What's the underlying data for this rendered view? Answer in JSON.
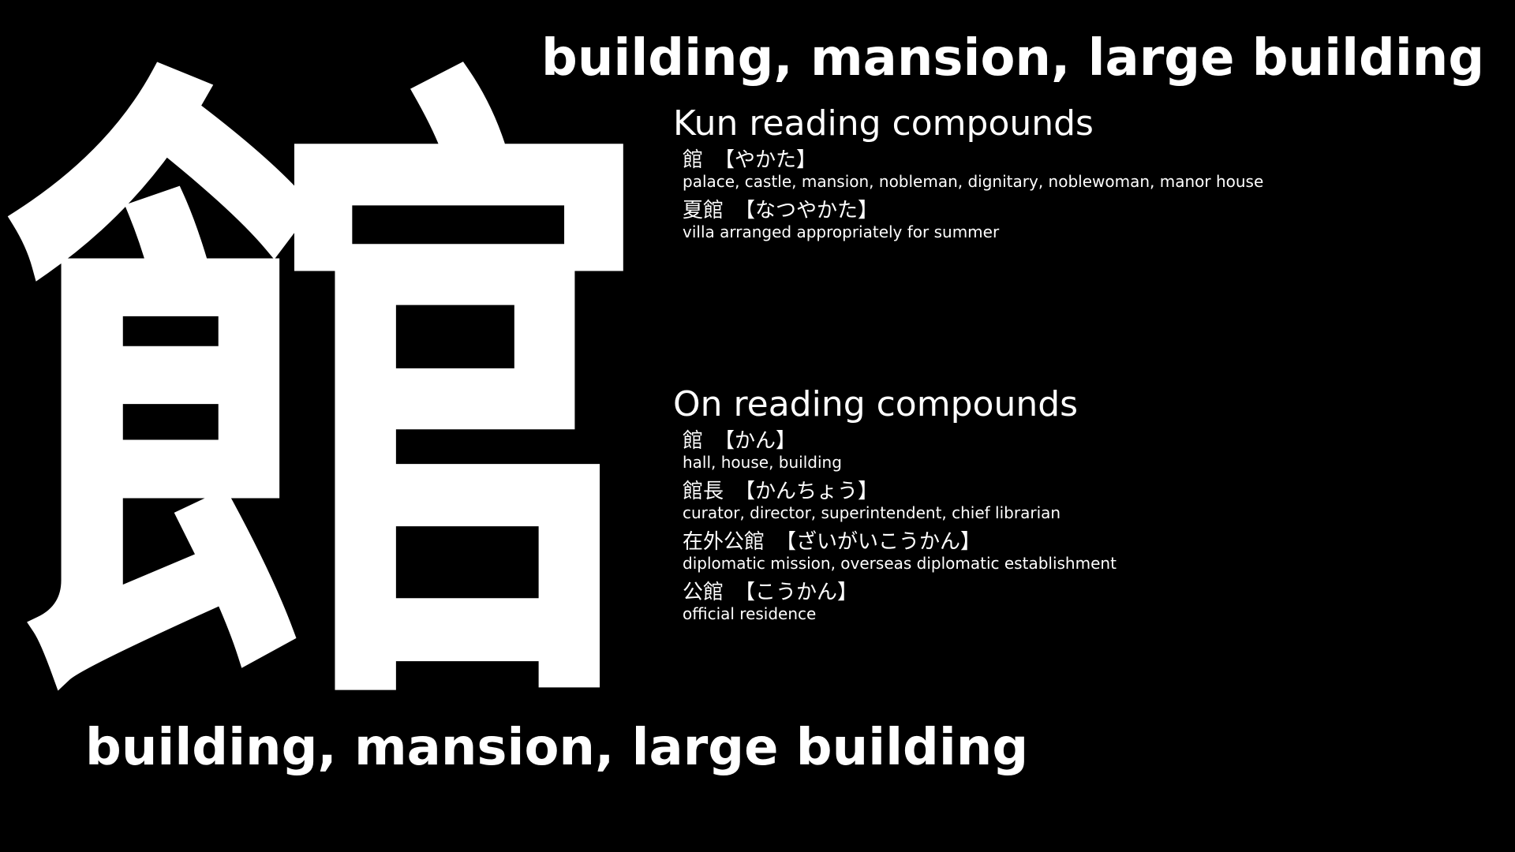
{
  "kanji": "館",
  "meaning_top": "building, mansion, large building",
  "meaning_bottom": "building, mansion, large building",
  "kun": {
    "heading": "Kun reading compounds",
    "entries": [
      {
        "word": "館",
        "reading": "【やかた】",
        "meaning": "palace, castle, mansion, nobleman, dignitary, noblewoman, manor house"
      },
      {
        "word": "夏館",
        "reading": "【なつやかた】",
        "meaning": "villa arranged appropriately for summer"
      }
    ]
  },
  "on": {
    "heading": "On reading compounds",
    "entries": [
      {
        "word": "館",
        "reading": "【かん】",
        "meaning": "hall, house, building"
      },
      {
        "word": "館長",
        "reading": "【かんちょう】",
        "meaning": "curator, director, superintendent, chief librarian"
      },
      {
        "word": "在外公館",
        "reading": "【ざいがいこうかん】",
        "meaning": "diplomatic mission, overseas diplomatic establishment"
      },
      {
        "word": "公館",
        "reading": "【こうかん】",
        "meaning": "official residence"
      }
    ]
  },
  "colors": {
    "background": "#000000",
    "text": "#ffffff"
  }
}
